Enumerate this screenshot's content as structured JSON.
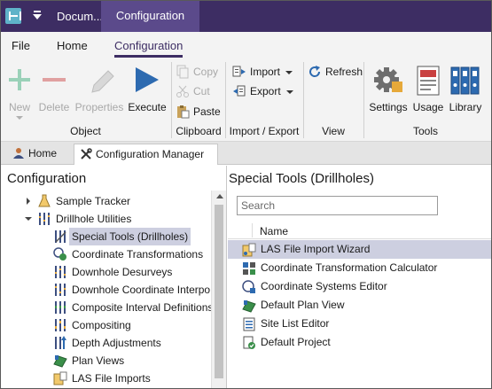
{
  "titlebar": {
    "document_title": "Docum...",
    "context_tab": "Configuration",
    "logo_icon": "app-logo-icon",
    "menu_icon": "quick-access-menu-icon"
  },
  "ribbon_tabs": [
    {
      "label": "File"
    },
    {
      "label": "Home"
    },
    {
      "label": "Configuration",
      "active": true
    }
  ],
  "ribbon": {
    "object": {
      "label": "Object",
      "new": "New",
      "delete": "Delete",
      "properties": "Properties",
      "execute": "Execute"
    },
    "clipboard": {
      "label": "Clipboard",
      "copy": "Copy",
      "cut": "Cut",
      "paste": "Paste"
    },
    "import_export": {
      "label": "Import / Export",
      "import": "Import",
      "export": "Export"
    },
    "view": {
      "label": "View",
      "refresh": "Refresh"
    },
    "tools": {
      "label": "Tools",
      "settings": "Settings",
      "usage": "Usage",
      "library": "Library"
    }
  },
  "doc_tabs": [
    {
      "label": "Home"
    },
    {
      "label": "Configuration Manager",
      "active": true
    }
  ],
  "left_pane": {
    "title": "Configuration",
    "tree": [
      {
        "label": "Sample Tracker",
        "icon": "flask-icon",
        "state": "collapsed"
      },
      {
        "label": "Drillhole Utilities",
        "icon": "drillhole-icon",
        "state": "expanded"
      },
      {
        "label": "Special Tools (Drillholes)",
        "icon": "drillhole-tools-icon",
        "selected": true
      },
      {
        "label": "Coordinate Transformations",
        "icon": "coordinate-transform-icon"
      },
      {
        "label": "Downhole Desurveys",
        "icon": "drillhole-icon"
      },
      {
        "label": "Downhole Coordinate Interpo",
        "icon": "drillhole-icon"
      },
      {
        "label": "Composite Interval Definitions",
        "icon": "drillhole-icon"
      },
      {
        "label": "Compositing",
        "icon": "drillhole-icon"
      },
      {
        "label": "Depth Adjustments",
        "icon": "depth-adjust-icon"
      },
      {
        "label": "Plan Views",
        "icon": "plan-view-icon"
      },
      {
        "label": "LAS File Imports",
        "icon": "las-file-icon"
      }
    ]
  },
  "right_pane": {
    "title": "Special Tools (Drillholes)",
    "search_placeholder": "Search",
    "column_name": "Name",
    "items": [
      {
        "label": "LAS File Import Wizard",
        "icon": "las-wizard-icon",
        "selected": true
      },
      {
        "label": "Coordinate Transformation Calculator",
        "icon": "calculator-icon"
      },
      {
        "label": "Coordinate Systems Editor",
        "icon": "coordinate-editor-icon"
      },
      {
        "label": "Default Plan View",
        "icon": "plan-view-icon"
      },
      {
        "label": "Site List Editor",
        "icon": "list-editor-icon"
      },
      {
        "label": "Default Project",
        "icon": "project-icon"
      }
    ]
  },
  "colors": {
    "titlebar": "#3d2d63",
    "context_tab": "#5b4a8b",
    "selection": "#cdcfe0",
    "execute_blue": "#2d6ab0"
  }
}
